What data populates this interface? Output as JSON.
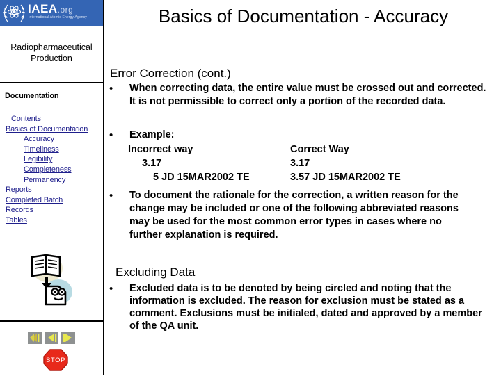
{
  "sidebar": {
    "logo": {
      "emblem_icon": "iaea-atom-laurel-icon",
      "wordmark": "IAEA",
      "org_suffix": ".org",
      "subtitle": "International Atomic Energy Agency",
      "banner_color": "#3465b4"
    },
    "course_title": "Radiopharmaceutical Production",
    "section_heading": "Documentation",
    "nav_links": [
      {
        "label": "Contents",
        "level": 0,
        "extra_indent": true
      },
      {
        "label": "Basics of Documentation",
        "level": 0
      },
      {
        "label": "Accuracy",
        "level": 1
      },
      {
        "label": "Timeliness",
        "level": 1
      },
      {
        "label": "Legibility",
        "level": 1
      },
      {
        "label": "Completeness",
        "level": 1
      },
      {
        "label": "Permanency",
        "level": 1
      },
      {
        "label": "Reports",
        "level": 0
      },
      {
        "label": "Completed Batch",
        "level": 0
      },
      {
        "label": "Records",
        "level": 0
      },
      {
        "label": "Tables",
        "level": 0
      }
    ],
    "link_color": "#1f1f8c",
    "graphic_icon": "open-book-to-document-icon",
    "nav_buttons": [
      {
        "icon": "first-slide-icon",
        "title": "First"
      },
      {
        "icon": "previous-slide-icon",
        "title": "Back"
      },
      {
        "icon": "next-slide-icon",
        "title": "Next"
      }
    ],
    "stop_button": {
      "icon": "stop-sign-icon",
      "label": "STOP",
      "color": "#e8291b"
    }
  },
  "main": {
    "slide_title": "Basics of Documentation - Accuracy",
    "heading_error": "Error Correction (cont.)",
    "heading_exclude": "Excluding Data",
    "bullet_1": "When correcting data, the entire value must be crossed out and corrected.  It is not permissible to correct only a portion of the recorded data.",
    "bullet_2": "Example:",
    "example": {
      "col_a_header": "Incorrect way",
      "col_b_header": "Correct Way",
      "incorrect_value_keep": "3",
      "incorrect_value_struck": ".17",
      "correct_value_struck": "3.17",
      "incorrect_correction": "5  JD   15MAR2002 TE",
      "correct_correction": "3.57   JD   15MAR2002 TE"
    },
    "bullet_3": "To document the rationale for the correction, a written reason for the change may be included or one of the following abbreviated reasons may be used for the most common error types in cases where no further explanation is required.",
    "bullet_4": "Excluded data is to be denoted by being circled and noting that the information is excluded.  The reason for exclusion must be stated as a comment.  Exclusions must be initialed, dated and approved by a member of the QA unit.",
    "bullet_glyph": "•"
  }
}
